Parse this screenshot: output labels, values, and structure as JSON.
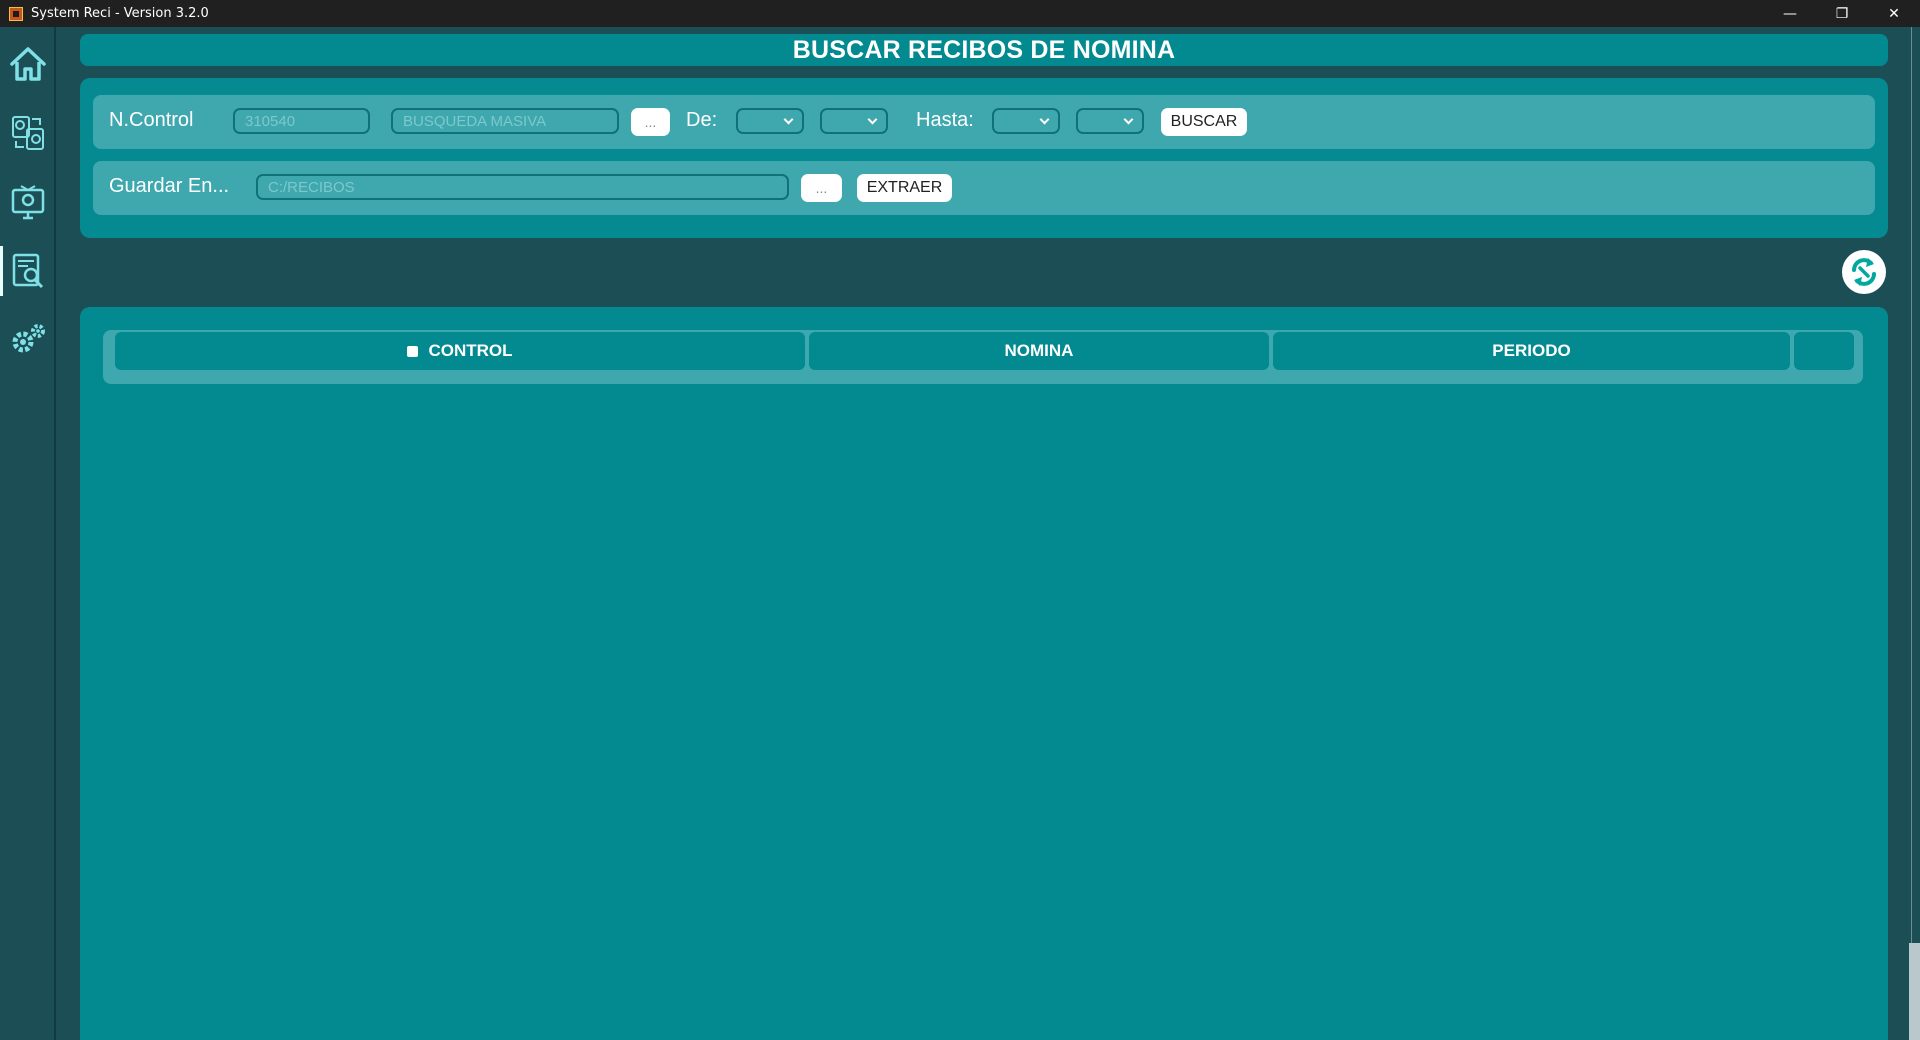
{
  "window": {
    "title": "System Reci - Version 3.2.0",
    "controls": {
      "minimize": "—",
      "maximize": "❐",
      "close": "✕"
    }
  },
  "sidebar": {
    "items": [
      {
        "id": "home",
        "icon": "home-icon"
      },
      {
        "id": "transfer",
        "icon": "file-transfer-icon"
      },
      {
        "id": "monitor",
        "icon": "monitor-gear-icon"
      },
      {
        "id": "search-receipts",
        "icon": "document-search-icon",
        "active": true
      },
      {
        "id": "settings",
        "icon": "gears-icon"
      }
    ]
  },
  "header": {
    "title": "BUSCAR RECIBOS DE NOMINA"
  },
  "search": {
    "control_label": "N.Control",
    "control_placeholder": "310540",
    "mass_placeholder": "BUSQUEDA MASIVA",
    "browse_label": "...",
    "from_label": "De:",
    "to_label": "Hasta:",
    "search_button": "BUSCAR"
  },
  "save": {
    "label": "Guardar En...",
    "path_placeholder": "C:/RECIBOS",
    "browse_label": "...",
    "extract_button": "EXTRAER"
  },
  "table": {
    "columns": [
      "CONTROL",
      "NOMINA",
      "PERIODO",
      ""
    ]
  },
  "colors": {
    "background": "#1b4f55",
    "panel": "#028a90",
    "row": "#3ea8ae",
    "accent": "#ffffff"
  }
}
